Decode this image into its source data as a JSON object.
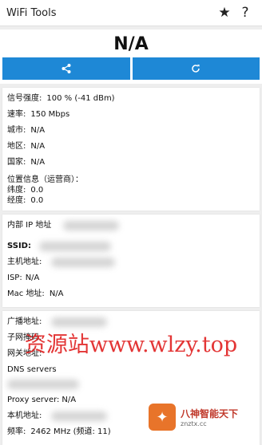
{
  "appbar": {
    "title": "WiFi Tools",
    "star_glyph": "★",
    "help_glyph": "?"
  },
  "header": {
    "value": "N/A"
  },
  "buttons": {
    "share_icon": "share-icon",
    "refresh_icon": "refresh-icon",
    "color": "#1e88d6"
  },
  "signal": {
    "strength_label": "信号强度:",
    "strength_value": "100 % (-41 dBm)",
    "speed_label": "速率:",
    "speed_value": "150 Mbps",
    "city_label": "城市:",
    "city_value": "N/A",
    "region_label": "地区:",
    "region_value": "N/A",
    "country_label": "国家:",
    "country_value": "N/A",
    "location_label": "位置信息（运营商）：",
    "lat_label": "纬度:",
    "lat_value": "0.0",
    "lon_label": "经度:",
    "lon_value": "0.0"
  },
  "network": {
    "ip_label": "内部 IP 地址",
    "ssid_label": "SSID:",
    "host_label": "主机地址:",
    "isp_label": "ISP:",
    "isp_value": "N/A",
    "mac_label": "Mac 地址:",
    "mac_value": "N/A"
  },
  "dns": {
    "broadcast_label": "广播地址:",
    "mask_label": "子网掩码:",
    "gateway_label": "网关地址:",
    "dns_label": "DNS servers",
    "proxy_label": "Proxy server:",
    "proxy_value": "N/A",
    "local_label": "本机地址:",
    "freq_label": "频率:",
    "freq_value": "2462 MHz (频道: 11)"
  },
  "watermark": {
    "text": "资源站www.wlzy.top"
  },
  "badge": {
    "line1": "八神智能天下",
    "line2": "znztx.cc"
  }
}
